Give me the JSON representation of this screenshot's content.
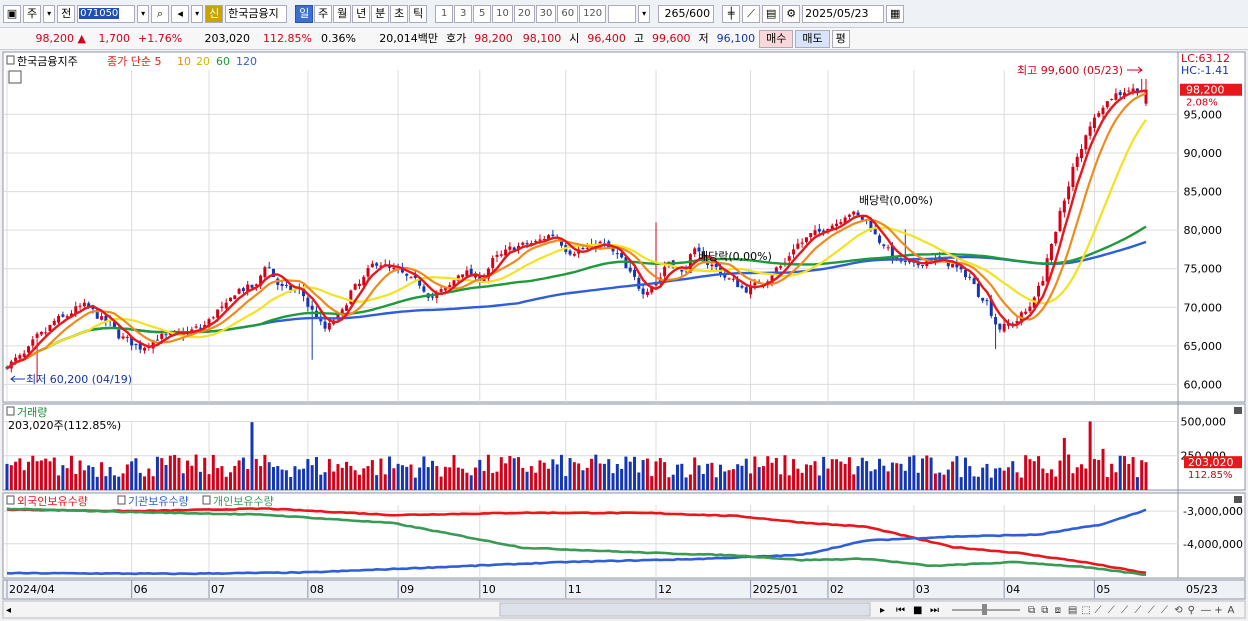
{
  "toolbar": {
    "btn_jong": "주",
    "btn_jeon": "전",
    "code": "071050",
    "sin": "신",
    "stock_name": "한국금융지",
    "periods": [
      "일",
      "주",
      "월",
      "년",
      "분",
      "초",
      "틱"
    ],
    "active_period": "일",
    "intervals": [
      "1",
      "3",
      "5",
      "10",
      "20",
      "30",
      "60",
      "120"
    ],
    "count": "265",
    "count_total": "/600",
    "date": "2025/05/23"
  },
  "quote": {
    "price": "98,200",
    "change": "1,700",
    "change_pct": "+1.76%",
    "volume": "203,020",
    "volume_ratio": "112.85%",
    "turnover": "0.36%",
    "amount": "20,014백만",
    "hoga_label": "호가",
    "ask": "98,200",
    "bid": "98,100",
    "open_label": "시",
    "open": "96,400",
    "high_label": "고",
    "high": "99,600",
    "low_label": "저",
    "low": "96,100",
    "buy_label": "매수",
    "sell_label": "매도",
    "pyeong_label": "평"
  },
  "colors": {
    "up": "#d4001a",
    "down": "#1436b4",
    "ma5": "#e8171b",
    "ma10": "#f08a1c",
    "ma20": "#f4e21e",
    "ma60": "#1e9a3a",
    "ma120": "#2f5fd8",
    "foreign": "#e8171b",
    "institution": "#2f5fd8",
    "individual": "#3a9a55"
  },
  "chart_data": [
    {
      "type": "candlestick",
      "title": "한국금융지주",
      "legend": {
        "prefix": "종가 단순",
        "periods": [
          "5",
          "10",
          "20",
          "60",
          "120"
        ]
      },
      "ylim": [
        58500,
        100500
      ],
      "yticks": [
        "95,000",
        "90,000",
        "85,000",
        "80,000",
        "75,000",
        "70,000",
        "65,000",
        "60,000"
      ],
      "yticks_values": [
        95000,
        90000,
        85000,
        80000,
        75000,
        70000,
        65000,
        60000
      ],
      "right_labels": {
        "lc": "LC:63.12",
        "hc": "HC:-1.41",
        "price": "98,200",
        "pct": "2.08%"
      },
      "x_months": [
        "2024/04",
        "06",
        "07",
        "08",
        "09",
        "10",
        "11",
        "12",
        "2025/01",
        "02",
        "03",
        "04",
        "05"
      ],
      "x_end_label": "05/23",
      "x_months_index": [
        0,
        29,
        47,
        70,
        91,
        110,
        130,
        151,
        173,
        191,
        211,
        232,
        253
      ],
      "annotations": {
        "max": "최고 99,600 (05/23)",
        "min": "최저 60,200 (04/19)",
        "dividend1": "배당락(0,00%)",
        "dividend2": "배당락(0,00%)"
      },
      "anchors": [
        [
          0,
          62500
        ],
        [
          3,
          63500
        ],
        [
          8,
          66500
        ],
        [
          12,
          68500
        ],
        [
          18,
          70200
        ],
        [
          23,
          68200
        ],
        [
          27,
          66000
        ],
        [
          31,
          64800
        ],
        [
          36,
          66200
        ],
        [
          41,
          66600
        ],
        [
          45,
          67400
        ],
        [
          50,
          69800
        ],
        [
          54,
          72300
        ],
        [
          58,
          72700
        ],
        [
          60,
          75500
        ],
        [
          64,
          72500
        ],
        [
          68,
          72200
        ],
        [
          71,
          69500
        ],
        [
          74,
          67200
        ],
        [
          77,
          68800
        ],
        [
          81,
          72600
        ],
        [
          86,
          75800
        ],
        [
          90,
          74800
        ],
        [
          95,
          73400
        ],
        [
          99,
          71300
        ],
        [
          102,
          72400
        ],
        [
          106,
          74600
        ],
        [
          110,
          73600
        ],
        [
          114,
          76500
        ],
        [
          118,
          77800
        ],
        [
          122,
          78300
        ],
        [
          127,
          79400
        ],
        [
          131,
          77200
        ],
        [
          135,
          77600
        ],
        [
          138,
          78300
        ],
        [
          142,
          76800
        ],
        [
          145,
          74300
        ],
        [
          148,
          72100
        ],
        [
          151,
          73200
        ],
        [
          154,
          76000
        ],
        [
          157,
          74400
        ],
        [
          160,
          77200
        ],
        [
          164,
          75400
        ],
        [
          168,
          73600
        ],
        [
          172,
          72300
        ],
        [
          176,
          73400
        ],
        [
          180,
          75300
        ],
        [
          184,
          78200
        ],
        [
          188,
          79600
        ],
        [
          192,
          80700
        ],
        [
          196,
          82200
        ],
        [
          200,
          81300
        ],
        [
          203,
          78600
        ],
        [
          207,
          76100
        ],
        [
          211,
          75400
        ],
        [
          215,
          76300
        ],
        [
          219,
          75700
        ],
        [
          223,
          74300
        ],
        [
          227,
          71300
        ],
        [
          231,
          67300
        ],
        [
          234,
          67900
        ],
        [
          237,
          69400
        ],
        [
          240,
          72400
        ],
        [
          243,
          77800
        ],
        [
          246,
          84200
        ],
        [
          249,
          89300
        ],
        [
          252,
          93700
        ],
        [
          255,
          96300
        ],
        [
          258,
          97600
        ],
        [
          261,
          98200
        ]
      ],
      "lows": [
        {
          "i": 7,
          "v": 60200
        }
      ],
      "highs": [
        {
          "i": 264,
          "v": 99600
        }
      ]
    },
    {
      "type": "bar",
      "title": "거래량",
      "value_label": "203,020주(112.85%)",
      "ylim": [
        0,
        540000
      ],
      "yticks": [
        "500,000",
        "250,000"
      ],
      "yticks_values": [
        500000,
        250000
      ],
      "right_labels": {
        "vol": "203,020",
        "pct": "112.85%"
      },
      "spikes": [
        {
          "i": 57,
          "v": 495000
        },
        {
          "i": 252,
          "v": 500000
        },
        {
          "i": 246,
          "v": 380000
        },
        {
          "i": 255,
          "v": 300000
        },
        {
          "i": 259,
          "v": 250000
        }
      ]
    },
    {
      "type": "line",
      "legend": [
        "외국인보유수량",
        "기관보유수량",
        "개인보유수량"
      ],
      "ylim": [
        -5050000,
        -2750000
      ],
      "yticks": [
        "-3,000,000",
        "-4,000,000"
      ],
      "yticks_values": [
        -3000000,
        -4000000
      ],
      "series": [
        {
          "name": "외국인보유수량",
          "anchors": [
            [
              0,
              -2950000
            ],
            [
              30,
              -3000000
            ],
            [
              60,
              -2920000
            ],
            [
              90,
              -3120000
            ],
            [
              120,
              -3050000
            ],
            [
              150,
              -3060000
            ],
            [
              170,
              -3150000
            ],
            [
              185,
              -3350000
            ],
            [
              200,
              -3480000
            ],
            [
              220,
              -4100000
            ],
            [
              235,
              -4280000
            ],
            [
              250,
              -4550000
            ],
            [
              265,
              -4900000
            ]
          ]
        },
        {
          "name": "기관보유수량",
          "anchors": [
            [
              0,
              -4900000
            ],
            [
              40,
              -4920000
            ],
            [
              70,
              -4880000
            ],
            [
              100,
              -4720000
            ],
            [
              130,
              -4560000
            ],
            [
              160,
              -4470000
            ],
            [
              185,
              -4340000
            ],
            [
              200,
              -3900000
            ],
            [
              220,
              -3780000
            ],
            [
              240,
              -3720000
            ],
            [
              255,
              -3400000
            ],
            [
              265,
              -2960000
            ]
          ]
        },
        {
          "name": "개인보유수량",
          "anchors": [
            [
              0,
              -2930000
            ],
            [
              30,
              -3030000
            ],
            [
              60,
              -3110000
            ],
            [
              90,
              -3370000
            ],
            [
              120,
              -4120000
            ],
            [
              150,
              -4280000
            ],
            [
              170,
              -4360000
            ],
            [
              185,
              -4500000
            ],
            [
              200,
              -4460000
            ],
            [
              215,
              -4680000
            ],
            [
              235,
              -4560000
            ],
            [
              250,
              -4710000
            ],
            [
              265,
              -4950000
            ]
          ]
        }
      ]
    }
  ]
}
